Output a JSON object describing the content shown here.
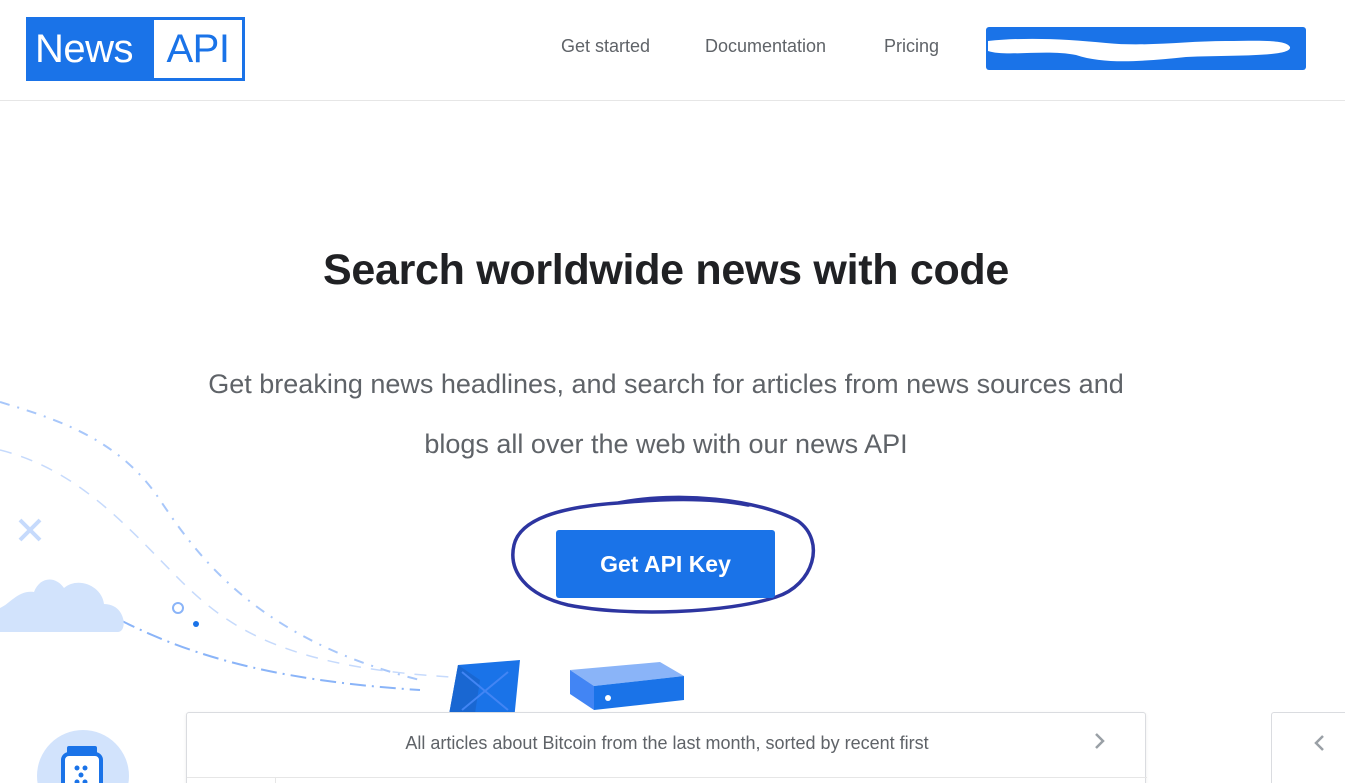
{
  "brand": {
    "logo_left": "News",
    "logo_right": "API",
    "color": "#1a73e8"
  },
  "nav": {
    "get_started": "Get started",
    "documentation": "Documentation",
    "pricing": "Pricing"
  },
  "hero": {
    "title": "Search worldwide news with code",
    "subtitle": "Get breaking news headlines, and search for articles from news sources and blogs all over the web with our news API",
    "cta_label": "Get API Key"
  },
  "examples": {
    "current": "All articles about Bitcoin from the last month, sorted by recent first"
  },
  "icons": {
    "next": "chevron-right-icon",
    "prev": "chevron-left-icon"
  }
}
